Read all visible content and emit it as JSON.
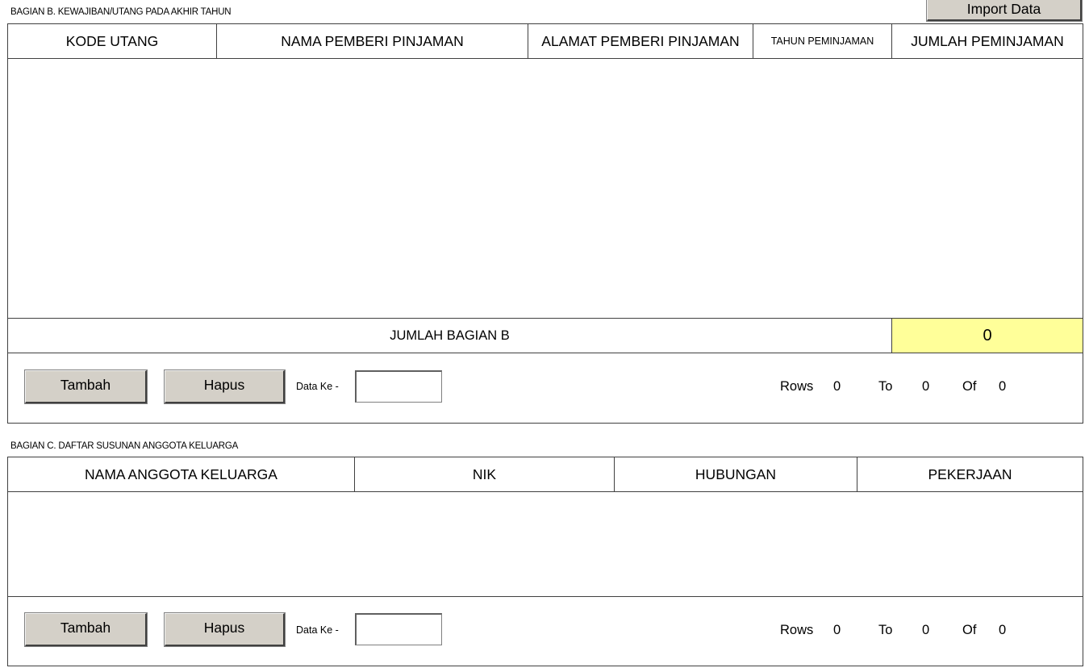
{
  "toolbar": {
    "import_label": "Import Data"
  },
  "bagian_b": {
    "title": "BAGIAN B. KEWAJIBAN/UTANG PADA AKHIR TAHUN",
    "columns": [
      "KODE UTANG",
      "NAMA PEMBERI PINJAMAN",
      "ALAMAT PEMBERI PINJAMAN",
      "TAHUN PEMINJAMAN",
      "JUMLAH PEMINJAMAN"
    ],
    "rows": [],
    "total_label": "JUMLAH BAGIAN B",
    "total_value": "0",
    "controls": {
      "add_label": "Tambah",
      "delete_label": "Hapus",
      "data_ke_label": "Data Ke -",
      "data_ke_value": "",
      "rows_label": "Rows",
      "rows_value": "0",
      "to_label": "To",
      "to_value": "0",
      "of_label": "Of",
      "of_value": "0"
    }
  },
  "bagian_c": {
    "title": "BAGIAN C. DAFTAR SUSUNAN ANGGOTA KELUARGA",
    "columns": [
      "NAMA ANGGOTA KELUARGA",
      "NIK",
      "HUBUNGAN",
      "PEKERJAAN"
    ],
    "rows": [],
    "controls": {
      "add_label": "Tambah",
      "delete_label": "Hapus",
      "data_ke_label": "Data Ke -",
      "data_ke_value": "",
      "rows_label": "Rows",
      "rows_value": "0",
      "to_label": "To",
      "to_value": "0",
      "of_label": "Of",
      "of_value": "0"
    }
  },
  "colors": {
    "total_highlight": "#ffff99",
    "button_face": "#d4d0c8"
  }
}
